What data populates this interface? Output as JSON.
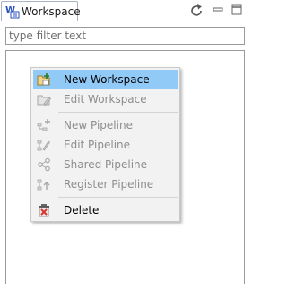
{
  "tab": {
    "label": "Workspace",
    "icon": "workspace-w-icon"
  },
  "toolbar": {
    "refresh_icon": "refresh-icon",
    "minimize_icon": "minimize-icon",
    "maximize_icon": "maximize-icon"
  },
  "filter": {
    "placeholder": "type filter text",
    "value": ""
  },
  "menu": {
    "items": [
      {
        "label": "New Workspace",
        "icon": "new-workspace-icon",
        "enabled": true,
        "selected": true
      },
      {
        "label": "Edit Workspace",
        "icon": "edit-workspace-icon",
        "enabled": false
      },
      {
        "label": "New Pipeline",
        "icon": "new-pipeline-icon",
        "enabled": false
      },
      {
        "label": "Edit Pipeline",
        "icon": "edit-pipeline-icon",
        "enabled": false
      },
      {
        "label": "Shared Pipeline",
        "icon": "share-icon",
        "enabled": false
      },
      {
        "label": "Register Pipeline",
        "icon": "register-pipeline-icon",
        "enabled": false
      },
      {
        "label": "Delete",
        "icon": "delete-icon",
        "enabled": true
      }
    ]
  },
  "colors": {
    "selection": "#91c9f7",
    "menu_bg": "#f2f2f2",
    "disabled_text": "#8d8d8d",
    "delete_red": "#d9342b"
  }
}
